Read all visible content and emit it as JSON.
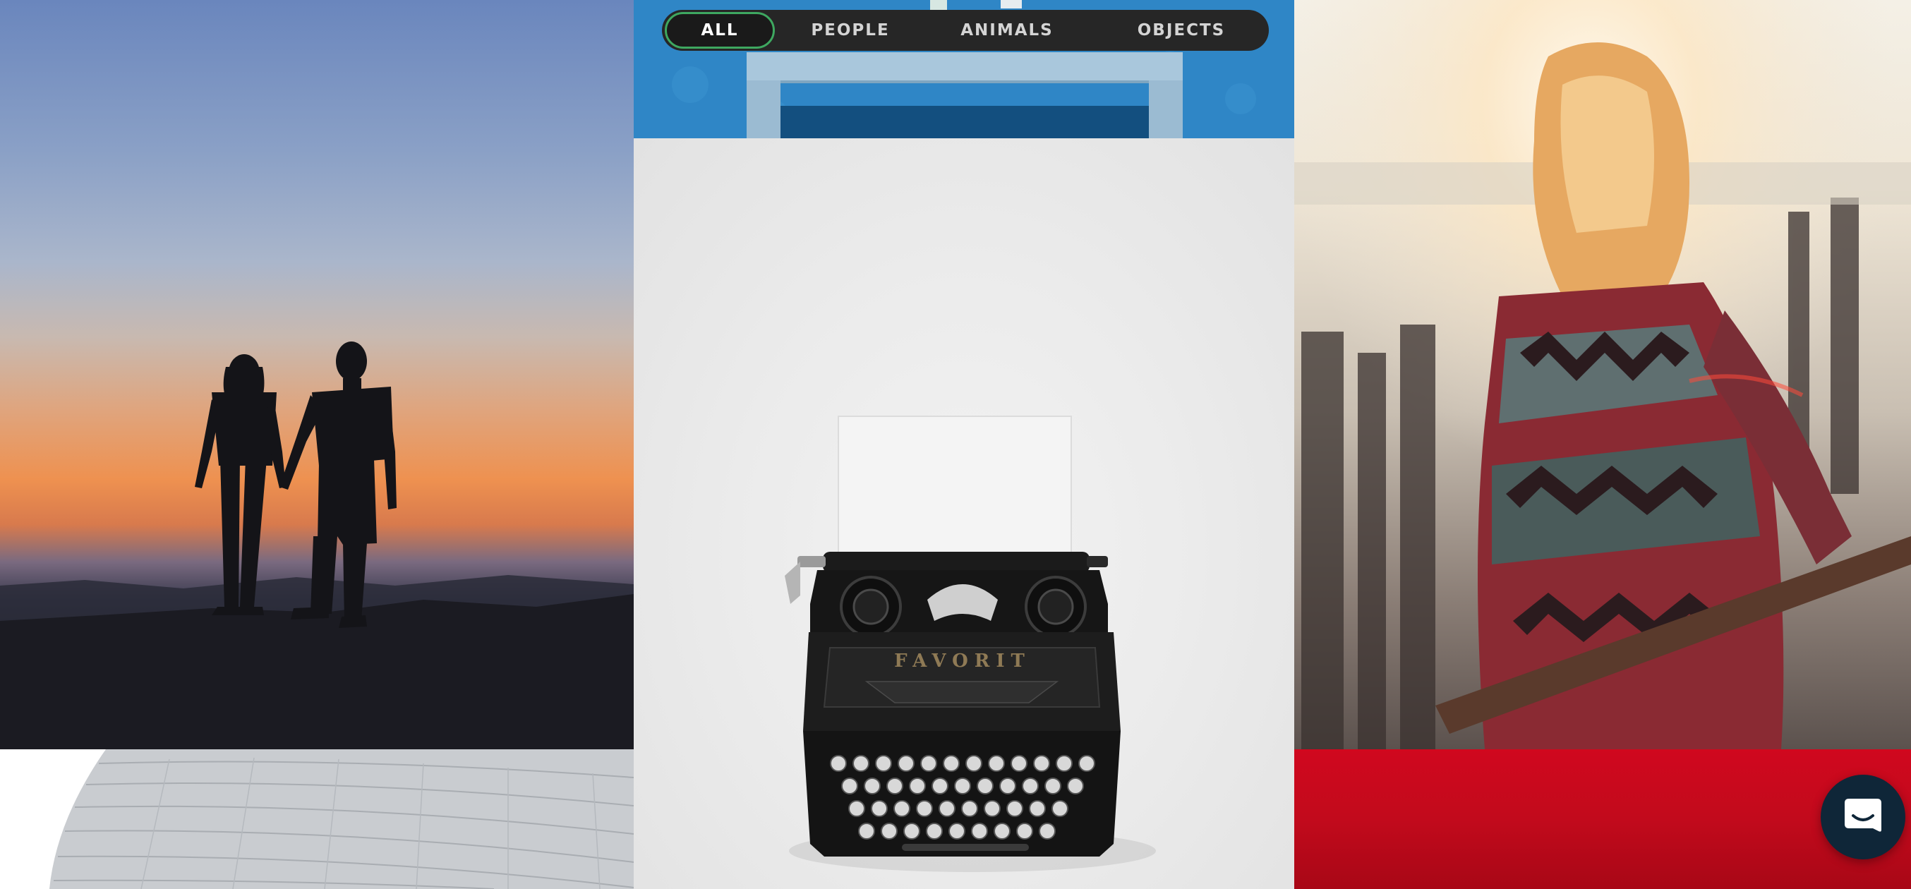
{
  "filters": {
    "all": "ALL",
    "people": "PEOPLE",
    "animals": "ANIMALS",
    "objects": "OBJECTS",
    "active": "ALL",
    "accent_color": "#3ea860"
  },
  "typewriter": {
    "brand": "FAVORIT"
  },
  "chat": {
    "icon": "chat-bubble-icon",
    "color": "#0f2638"
  }
}
